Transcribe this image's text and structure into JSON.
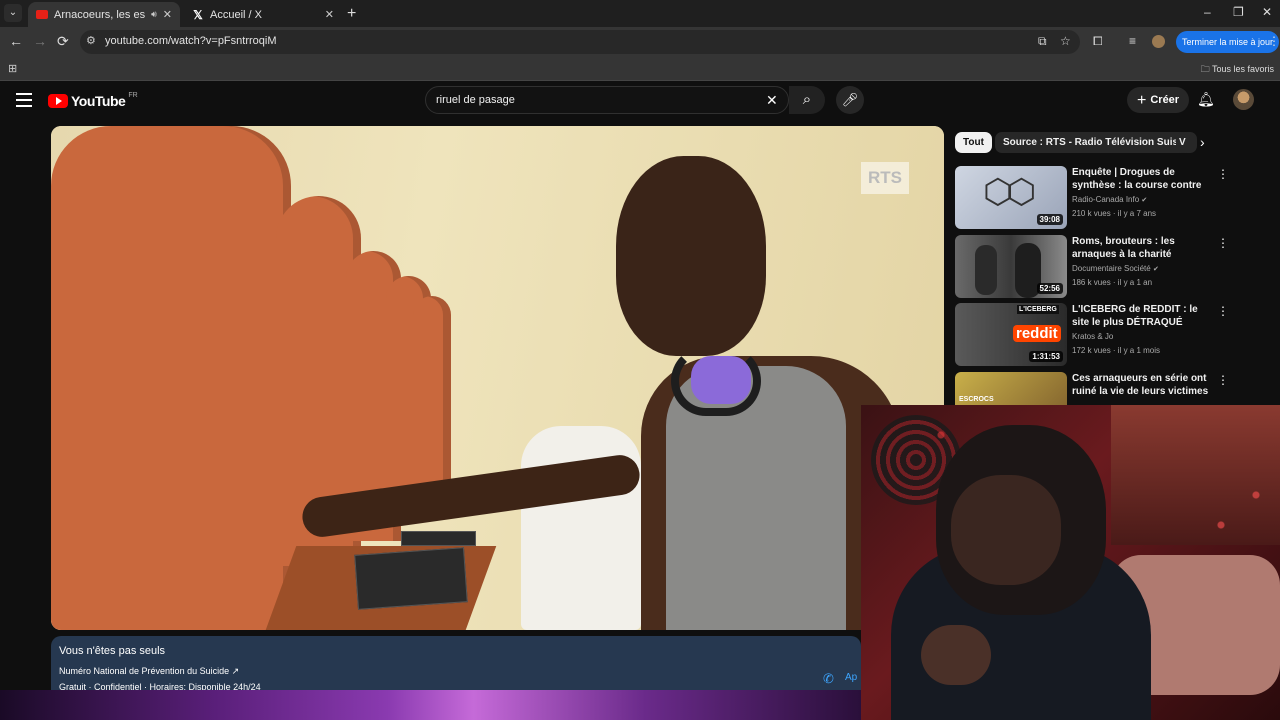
{
  "browser": {
    "tabs": [
      {
        "title": "Arnacoeurs, les escrocs de l",
        "active": true
      },
      {
        "title": "Accueil / X",
        "active": false
      }
    ],
    "url": "youtube.com/watch?v=pFsntrroqiM",
    "update_button": "Terminer la mise à jour",
    "bookmarks_folder": "Tous les favoris"
  },
  "youtube": {
    "logo_text": "YouTube",
    "country_code": "FR",
    "search_query": "riruel de pasage",
    "create_label": "Créer",
    "video": {
      "watermark": "RTS"
    },
    "info_panel": {
      "title": "Vous n'êtes pas seuls",
      "line1": "Numéro National de Prévention du Suicide ↗",
      "line2": "Gratuit · Confidentiel · Horaires: Disponible 24h/24",
      "call_label": "Ap"
    },
    "chips": [
      {
        "label": "Tout",
        "selected": true
      },
      {
        "label": "Source : RTS - Radio Télévision Suisse",
        "selected": false
      },
      {
        "label": "V",
        "selected": false
      }
    ],
    "recommendations": [
      {
        "title": "Enquête | Drogues de synthèse : la course contre les chimistes",
        "channel": "Radio-Canada Info",
        "verified": true,
        "meta": "210 k vues · il y a 7 ans",
        "duration": "39:08"
      },
      {
        "title": "Roms, brouteurs : les arnaques à la charité",
        "channel": "Documentaire Société",
        "verified": true,
        "meta": "186 k vues · il y a 1 an",
        "duration": "52:56"
      },
      {
        "title": "L'ICEBERG de REDDIT : le site le plus DÉTRAQUÉ d'internet...",
        "channel": "Kratos & Jo",
        "verified": false,
        "meta": "172 k vues · il y a 1 mois",
        "duration": "1:31:53"
      },
      {
        "title": "Ces arnaqueurs en série ont ruiné la vie de leurs victimes",
        "channel": "",
        "verified": false,
        "meta": "",
        "duration": ""
      }
    ],
    "thumb_texts": {
      "rec3_badge": "L'ICEBERG",
      "rec3_word": "reddit",
      "rec4_badge": "ESCROCS"
    }
  },
  "icons": {
    "back": "←",
    "forward": "→",
    "reload": "⟳",
    "search": "⚲",
    "mic": "🎙",
    "bell": "🔔",
    "more": "⋮",
    "next": "›",
    "close": "✕",
    "plus": "+"
  }
}
